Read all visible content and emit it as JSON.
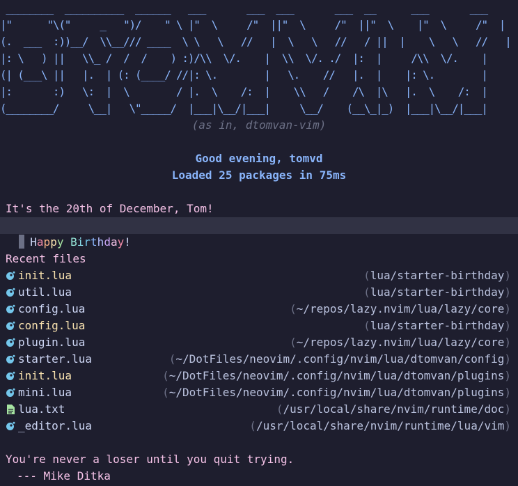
{
  "banner": {
    "ascii": " ________  __________  ______   ___       ___  ___       ___  __      ___       ___\n|\"      \"\\(\"     _   \")/    \" \\ |\"  \\     /\"  ||\"  \\     /\"  ||\"  \\    |\"  \\     /\"  |\n(.  ___  :))__/  \\\\__/// ____  \\ \\   \\   //   |  \\   \\   //   / ||  |    \\   \\   //   |\n|: \\   ) ||   \\\\_ /  /  /    ) :)/\\\\  \\/.    |  \\\\  \\/. ./  |:  |     /\\\\  \\/.    |\n(| (___\\ ||   |.  | (: (____/ //|: \\.        |   \\.    //   |.  |    |: \\.        |\n|:       :)   \\:  |  \\        / |.  \\    /:  |    \\\\   /    /\\  |\\   |.  \\    /:  |\n(________/     \\__|   \\\"_____/  |___|\\__/|___|     \\__/    (__\\_|_)  |___|\\__/|___|",
    "subtitle": "(as in, dtomvan-vim)",
    "overlay": "BTOMVAN"
  },
  "greeting": "Good evening, tomvd",
  "loaded": "Loaded 25 packages in 75ms",
  "date_line": "It's the 20th of December, Tom!",
  "birthday": {
    "letters": [
      "H",
      "a",
      "p",
      "p",
      "y",
      " ",
      "B",
      "i",
      "r",
      "t",
      "h",
      "d",
      "a",
      "y",
      "!"
    ],
    "colors": [
      "#cdd6f4",
      "#f38ba8",
      "#fab387",
      "#f9e2af",
      "#a6e3a1",
      " ",
      "#94e2d5",
      "#89dceb",
      "#74c7ec",
      "#89b4fa",
      "#b4befe",
      "#cba6f7",
      "#f5c2e7",
      "#f38ba8",
      "#cdd6f4"
    ]
  },
  "recent": {
    "title": "Recent files",
    "files": [
      {
        "icon": "lua-icon",
        "name": "init.lua",
        "name_color": "#f9e2af",
        "path": "lua/starter-birthday"
      },
      {
        "icon": "lua-icon",
        "name": "util.lua",
        "name_color": "#cdd6f4",
        "path": "lua/starter-birthday"
      },
      {
        "icon": "lua-icon",
        "name": "config.lua",
        "name_color": "#cdd6f4",
        "path": "~/repos/lazy.nvim/lua/lazy/core"
      },
      {
        "icon": "lua-icon",
        "name": "config.lua",
        "name_color": "#f9e2af",
        "path": "lua/starter-birthday"
      },
      {
        "icon": "lua-icon",
        "name": "plugin.lua",
        "name_color": "#cdd6f4",
        "path": "~/repos/lazy.nvim/lua/lazy/core"
      },
      {
        "icon": "lua-icon",
        "name": "starter.lua",
        "name_color": "#cdd6f4",
        "path": "~/DotFiles/neovim/.config/nvim/lua/dtomvan/config"
      },
      {
        "icon": "lua-icon",
        "name": "init.lua",
        "name_color": "#f9e2af",
        "path": "~/DotFiles/neovim/.config/nvim/lua/dtomvan/plugins"
      },
      {
        "icon": "lua-icon",
        "name": "mini.lua",
        "name_color": "#cdd6f4",
        "path": "~/DotFiles/neovim/.config/nvim/lua/dtomvan/plugins"
      },
      {
        "icon": "text-file-icon",
        "name": "lua.txt",
        "name_color": "#cdd6f4",
        "path": "/usr/local/share/nvim/runtime/doc"
      },
      {
        "icon": "lua-icon",
        "name": "_editor.lua",
        "name_color": "#cdd6f4",
        "path": "/usr/local/share/nvim/runtime/lua/vim"
      }
    ]
  },
  "quote": {
    "text": "You're never a loser until you quit trying.",
    "author": "--- Mike Ditka"
  },
  "colors": {
    "background": "#1e1e2e",
    "accent": "#89b4fa",
    "pink": "#f5c2e7",
    "lua_icon": "#74c7ec",
    "txt_icon": "#a6e3a1"
  }
}
